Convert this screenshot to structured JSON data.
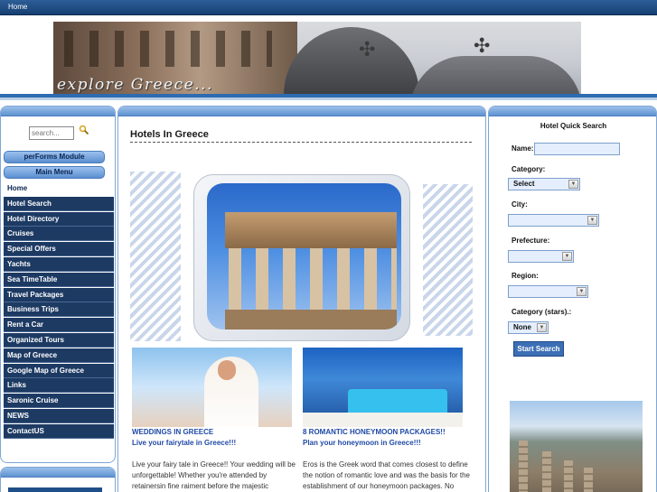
{
  "topbar": {
    "home_link": "Home"
  },
  "banner": {
    "title": "explore Greece..."
  },
  "left": {
    "search_placeholder": "search...",
    "module_button": "perForms Module",
    "main_menu_button": "Main Menu",
    "menu": [
      "Home",
      "Hotel Search",
      "Hotel Directory",
      "Cruises",
      "Special Offers",
      "Yachts",
      "Sea TimeTable",
      "Travel Packages",
      "Business Trips",
      "Rent a Car",
      "Organized Tours",
      "Map of Greece",
      "Google Map of Greece",
      "Links",
      "Saronic Cruise",
      "NEWS",
      "ContactUS"
    ]
  },
  "center": {
    "heading": "Hotels In Greece",
    "weddings_title": "WEDDINGS IN GREECE",
    "weddings_sub": "Live your fairytale in Greece!!!",
    "weddings_text": "Live your fairy tale in Greece!! Your wedding will be unforgettable! Whether you're attended by retainersin fine raiment before the majestic",
    "honeymoon_title": "8 ROMANTIC HONEYMOON PACKAGES!!",
    "honeymoon_sub": "Plan your honeymoon in Greece!!!",
    "honeymoon_text": "Eros is the Greek word that comes closest to define the notion of romantic love and was the basis for the establishment of our honeymoon packages. No"
  },
  "right": {
    "title": "Hotel Quick Search",
    "name_label": "Name:",
    "category_label": "Category:",
    "category_value": "Select",
    "city_label": "City:",
    "prefecture_label": "Prefecture:",
    "region_label": "Region:",
    "stars_label": "Category (stars).:",
    "stars_value": "None",
    "search_button": "Start Search"
  }
}
